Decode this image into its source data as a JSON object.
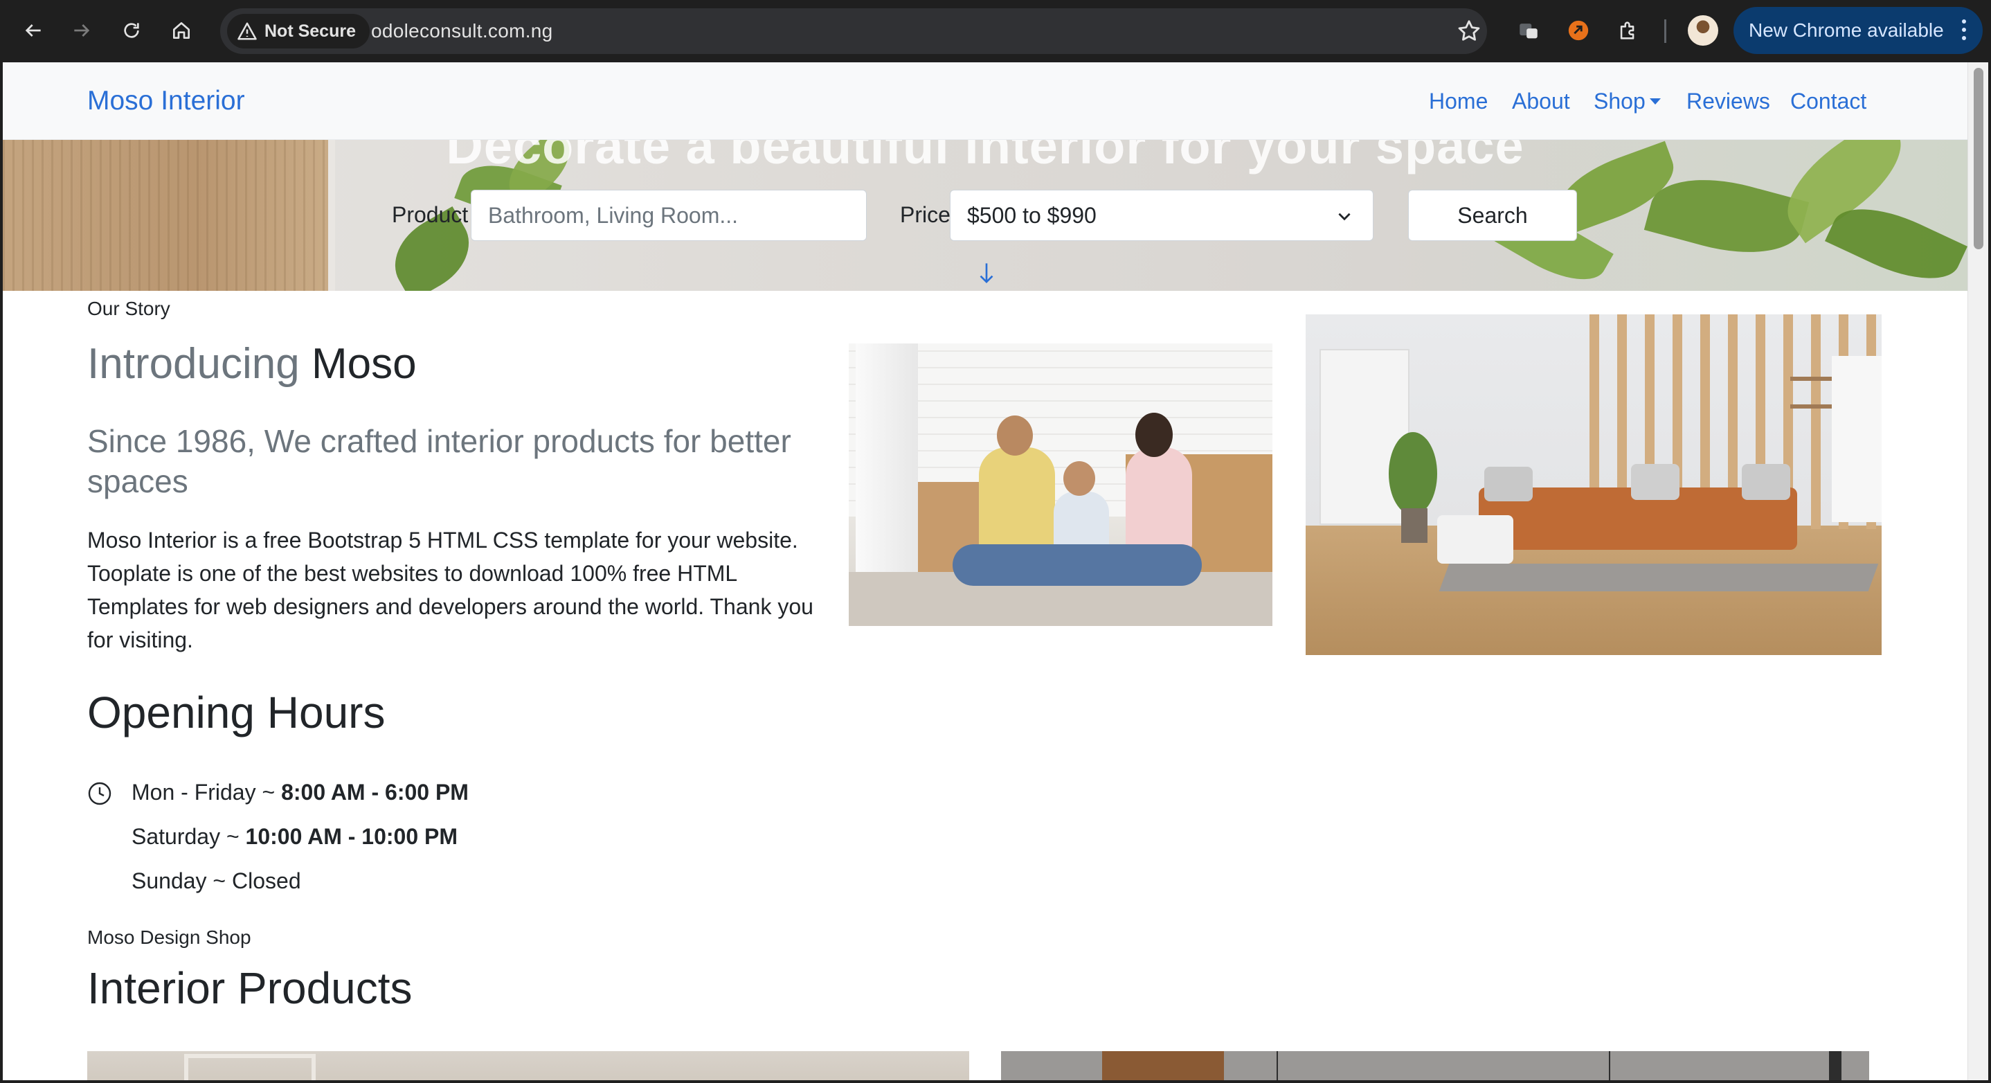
{
  "browser": {
    "security_label": "Not Secure",
    "url": "odoleconsult.com.ng",
    "update_label": "New Chrome available",
    "icons": [
      "back-icon",
      "forward-icon",
      "reload-icon",
      "home-icon",
      "warning-icon",
      "star-icon",
      "translate-icon",
      "extension-orange-icon",
      "puzzle-icon",
      "profile-avatar",
      "more-icon"
    ]
  },
  "nav": {
    "brand": "Moso Interior",
    "links": [
      "Home",
      "About",
      "Shop",
      "Reviews",
      "Contact"
    ]
  },
  "hero": {
    "title": "Decorate a beautiful interior for your space",
    "product_label": "Product",
    "product_placeholder": "Bathroom, Living Room...",
    "price_label": "Price",
    "price_value": "$500 to $990",
    "search_label": "Search"
  },
  "story": {
    "kicker": "Our Story",
    "heading_light": "Introducing",
    "heading_dark": "Moso",
    "subheading": "Since 1986, We crafted interior products for better spaces",
    "body": "Moso Interior is a free Bootstrap 5 HTML CSS template for your website. Tooplate is one of the best websites to download 100% free HTML Templates for web designers and developers around the world. Thank you for visiting."
  },
  "hours": {
    "heading": "Opening Hours",
    "rows": [
      {
        "day": "Mon - Friday ~ ",
        "time": "8:00 AM - 6:00 PM"
      },
      {
        "day": "Saturday ~ ",
        "time": "10:00 AM - 10:00 PM"
      },
      {
        "day": "Sunday ~ Closed",
        "time": ""
      }
    ]
  },
  "shop": {
    "kicker": "Moso Design Shop",
    "heading": "Interior Products"
  },
  "colors": {
    "link_blue": "#2a6fd6",
    "chrome_bg": "#1f1f1f",
    "update_chip": "#0b3b6e"
  }
}
